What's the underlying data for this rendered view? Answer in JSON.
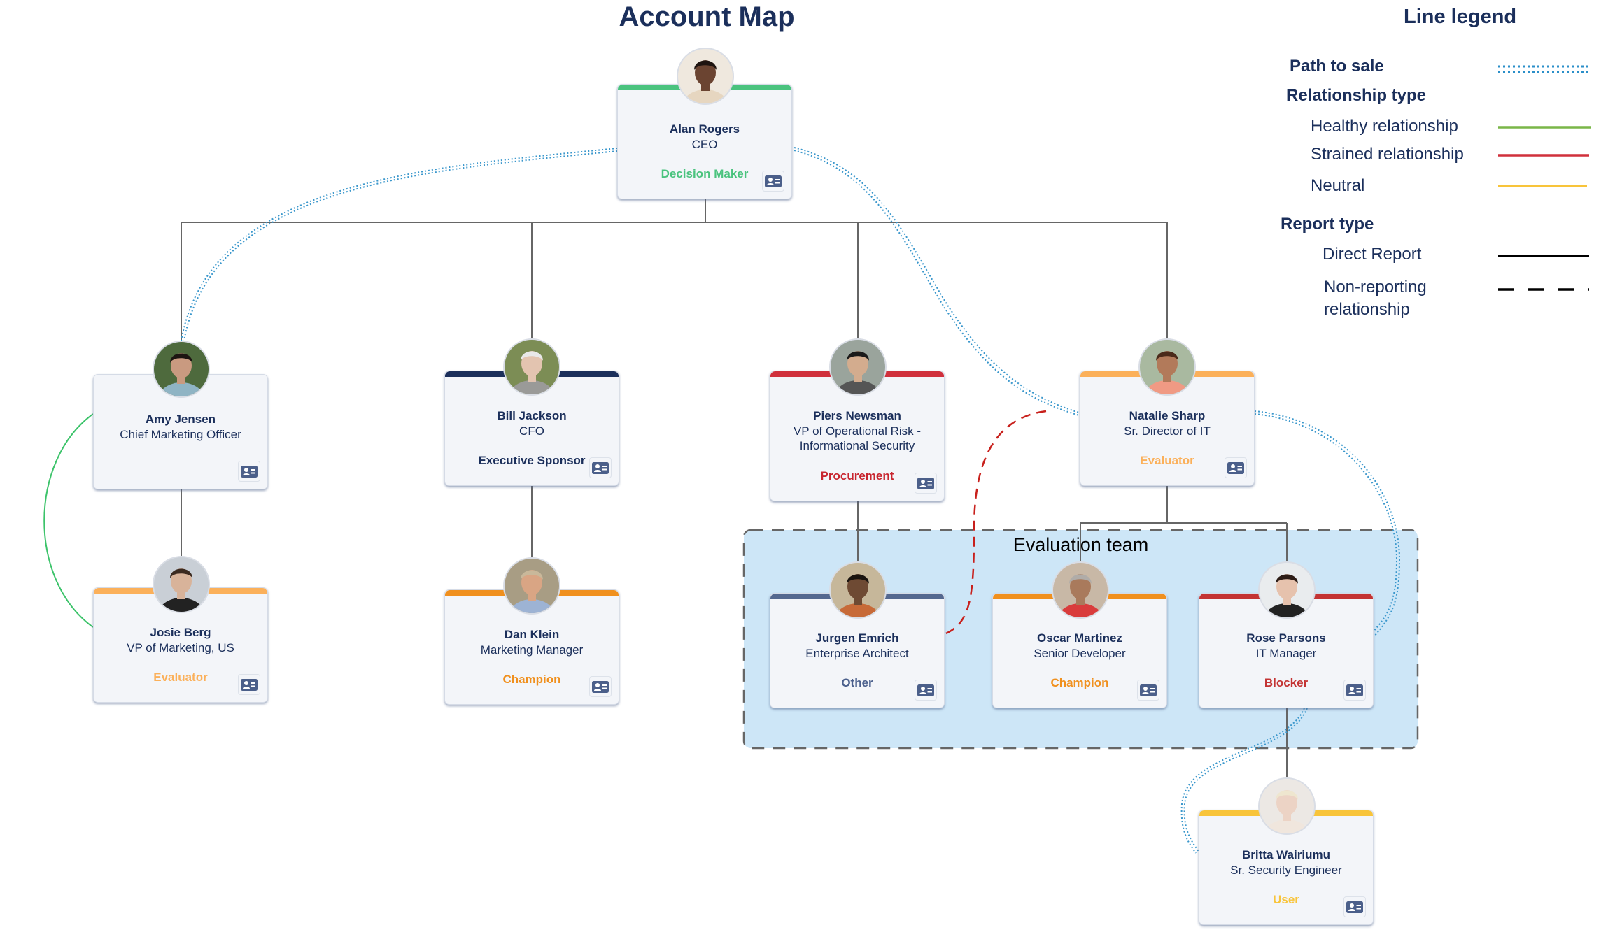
{
  "title": "Account Map",
  "legend": {
    "title": "Line legend",
    "path_to_sale": "Path to sale",
    "relationship_type": "Relationship type",
    "healthy": "Healthy relationship",
    "strained": "Strained relationship",
    "neutral": "Neutral",
    "report_type": "Report type",
    "direct_report": "Direct Report",
    "non_reporting_1": "Non-reporting",
    "non_reporting_2": "relationship",
    "colors": {
      "path_to_sale": "#2b8fc9",
      "healthy": "#7ab648",
      "strained": "#d0303c",
      "neutral": "#f8c43a",
      "report": "#000000"
    }
  },
  "team": {
    "label": "Evaluation team"
  },
  "people": [
    {
      "id": "alan",
      "name": "Alan Rogers",
      "title": "CEO",
      "role": "Decision Maker",
      "role_color": "#4ac37e",
      "bar_color": "#4ac37e"
    },
    {
      "id": "amy",
      "name": "Amy Jensen",
      "title": "Chief Marketing Officer",
      "role": "",
      "role_color": "",
      "bar_color": ""
    },
    {
      "id": "bill",
      "name": "Bill Jackson",
      "title": "CFO",
      "role": "Executive Sponsor",
      "role_color": "#1b2f5b",
      "bar_color": "#1b2f5b"
    },
    {
      "id": "piers",
      "name": "Piers Newsman",
      "title_line1": "VP of Operational Risk -",
      "title_line2": "Informational Security",
      "role": "Procurement",
      "role_color": "#c8252f",
      "bar_color": "#d0303c"
    },
    {
      "id": "natalie",
      "name": "Natalie Sharp",
      "title": "Sr. Director of IT",
      "role": "Evaluator",
      "role_color": "#fbb05a",
      "bar_color": "#fbb05a"
    },
    {
      "id": "josie",
      "name": "Josie Berg",
      "title": "VP of Marketing, US",
      "role": "Evaluator",
      "role_color": "#fbb05a",
      "bar_color": "#fbb05a"
    },
    {
      "id": "dan",
      "name": "Dan Klein",
      "title": "Marketing Manager",
      "role": "Champion",
      "role_color": "#f0901e",
      "bar_color": "#f0901e"
    },
    {
      "id": "jurgen",
      "name": "Jurgen Emrich",
      "title": "Enterprise Architect",
      "role": "Other",
      "role_color": "#4a5f8c",
      "bar_color": "#54688f"
    },
    {
      "id": "oscar",
      "name": "Oscar Martinez",
      "title": "Senior Developer",
      "role": "Champion",
      "role_color": "#f0901e",
      "bar_color": "#f0901e"
    },
    {
      "id": "rose",
      "name": "Rose Parsons",
      "title": "IT Manager",
      "role": "Blocker",
      "role_color": "#c33333",
      "bar_color": "#c33333"
    },
    {
      "id": "britta",
      "name": "Britta Wairiumu",
      "title": "Sr. Security Engineer",
      "role": "User",
      "role_color": "#f8c43a",
      "bar_color": "#f8c43a"
    }
  ],
  "icons": {
    "contact_card": "contact-card-icon",
    "avatar": "avatar-photo"
  }
}
